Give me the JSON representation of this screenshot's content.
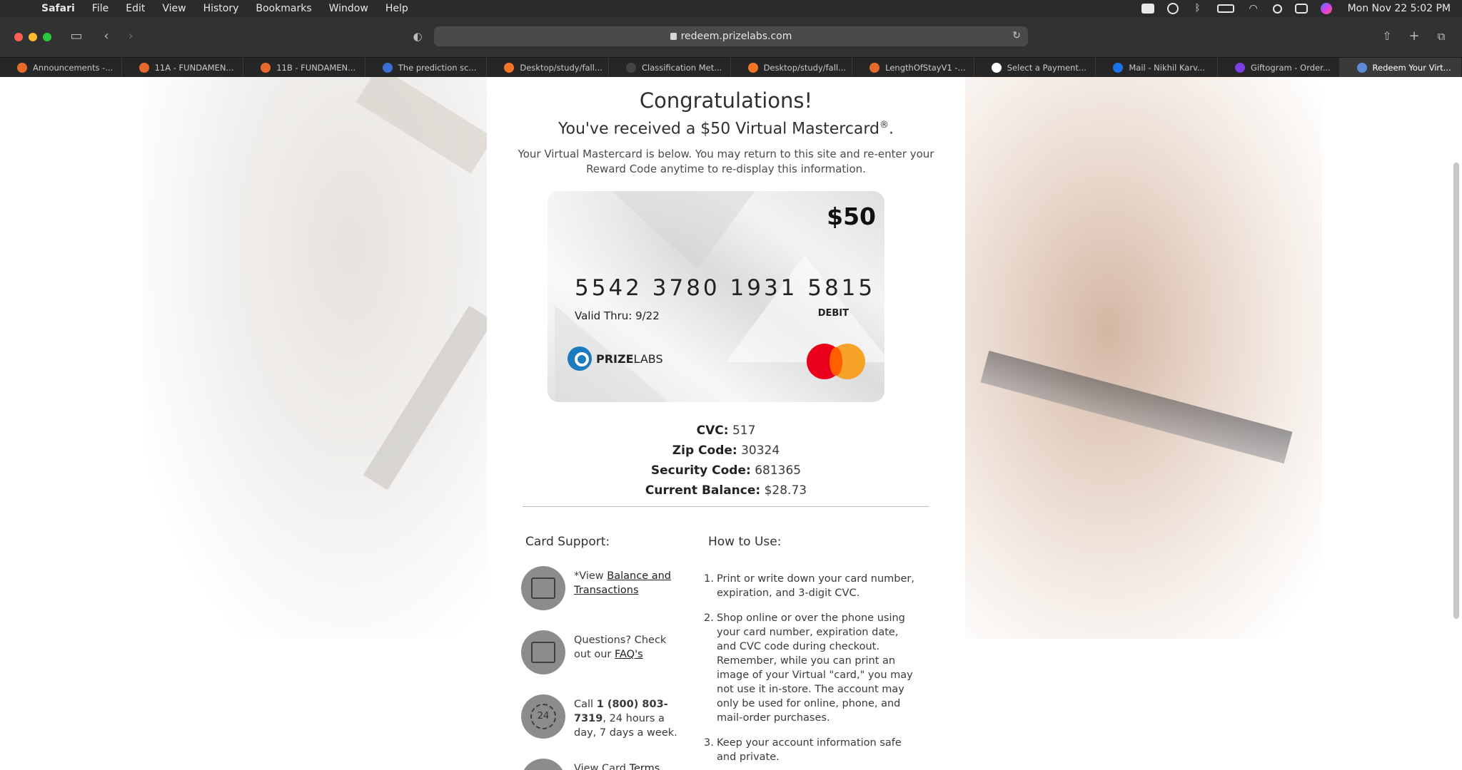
{
  "menubar": {
    "app": "Safari",
    "items": [
      "File",
      "Edit",
      "View",
      "History",
      "Bookmarks",
      "Window",
      "Help"
    ],
    "clock": "Mon Nov 22  5:02 PM"
  },
  "toolbar": {
    "url": "redeem.prizelabs.com"
  },
  "tabs": [
    {
      "label": "Announcements -...",
      "favicon_color": "#e8692c"
    },
    {
      "label": "11A - FUNDAMEN...",
      "favicon_color": "#e8692c"
    },
    {
      "label": "11B - FUNDAMEN...",
      "favicon_color": "#e8692c"
    },
    {
      "label": "The prediction sc...",
      "favicon_color": "#3b6fd6"
    },
    {
      "label": "Desktop/study/fall...",
      "favicon_color": "#f37626"
    },
    {
      "label": "Classification Met...",
      "favicon_color": "#444444"
    },
    {
      "label": "Desktop/study/fall...",
      "favicon_color": "#f37626"
    },
    {
      "label": "LengthOfStayV1 -...",
      "favicon_color": "#e8692c"
    },
    {
      "label": "Select a Payment...",
      "favicon_color": "#ffffff"
    },
    {
      "label": "Mail - Nikhil Karv...",
      "favicon_color": "#1a73e8"
    },
    {
      "label": "Giftogram - Order...",
      "favicon_color": "#7b3fe4"
    },
    {
      "label": "Redeem Your Virt...",
      "favicon_color": "#5b8bd9"
    }
  ],
  "page": {
    "title": "Congratulations!",
    "subtitle_prefix": "You've received a $50 Virtual Mastercard",
    "subtitle_reg": "®",
    "subtitle_suffix": ".",
    "intro": "Your Virtual Mastercard is below. You may return to this site and re-enter your Reward Code anytime to re-display this information.",
    "card": {
      "amount": "$50",
      "number": "5542 3780 1931 5815",
      "valid_thru": "Valid Thru: 9/22",
      "type": "DEBIT",
      "brand_bold": "PRIZE",
      "brand_light": "LABS"
    },
    "details": [
      {
        "label": "CVC:",
        "value": "517"
      },
      {
        "label": "Zip Code:",
        "value": "30324"
      },
      {
        "label": "Security Code:",
        "value": "681365"
      },
      {
        "label": "Current Balance:",
        "value": "$28.73"
      }
    ],
    "support": {
      "title": "Card Support:",
      "item1_prefix": "*View ",
      "item1_link": "Balance and Transactions",
      "item2_prefix": "Questions? Check out our ",
      "item2_link": "FAQ's",
      "item3_prefix": "Call ",
      "item3_phone": "1 (800) 803-7319",
      "item3_suffix": ", 24 hours a day, 7 days a week.",
      "item4_prefix": "View Card ",
      "item4_link": "Terms"
    },
    "howto": {
      "title": "How to Use:",
      "steps": [
        "Print or write down your card number, expiration, and 3-digit CVC.",
        "Shop online or over the phone using your card number, expiration date, and CVC code during checkout. Remember, while you can print an image of your Virtual \"card,\" you may not use it in-store. The account may only be used for online, phone, and mail-order purchases.",
        "Keep your account information safe and private."
      ]
    }
  },
  "colors": {
    "mastercard_red": "#eb001b",
    "mastercard_orange": "#f79e1b",
    "prizelabs_blue": "#1b7bbf"
  }
}
